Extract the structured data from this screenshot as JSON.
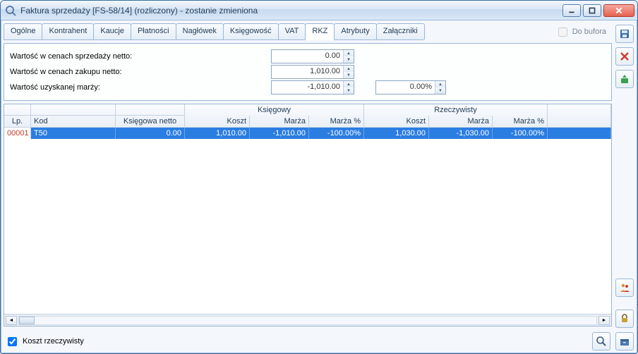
{
  "window": {
    "title": "Faktura sprzedaży [FS-58/14] (rozliczony) - zostanie zmieniona"
  },
  "tabs": [
    "Ogólne",
    "Kontrahent",
    "Kaucje",
    "Płatności",
    "Nagłówek",
    "Księgowość",
    "VAT",
    "RKZ",
    "Atrybuty",
    "Załączniki"
  ],
  "active_tab": "RKZ",
  "buffer_label": "Do bufora",
  "values": {
    "label_netto_sprz": "Wartość w cenach sprzedaży netto:",
    "label_netto_zakup": "Wartość w cenach zakupu netto:",
    "label_marza": "Wartość uzyskanej marży:",
    "netto_sprz": "0.00",
    "netto_zakup": "1,010.00",
    "marza": "-1,010.00",
    "marza_pct": "0.00%"
  },
  "grid": {
    "group1": "Księgowy",
    "group2": "Rzeczywisty",
    "headers": {
      "lp": "Lp.",
      "kod": "Kod",
      "kn": "Księgowa netto",
      "koszt": "Koszt",
      "marza": "Marża",
      "marza_pct": "Marża %"
    },
    "rows": [
      {
        "lp": "00001",
        "kod": "T50",
        "kn": "0.00",
        "k_koszt": "1,010.00",
        "k_marza": "-1,010.00",
        "k_marza_pct": "-100.00%",
        "r_koszt": "1,030.00",
        "r_marza": "-1,030.00",
        "r_marza_pct": "-100.00%"
      }
    ]
  },
  "checkbox_label": "Koszt rzeczywisty"
}
